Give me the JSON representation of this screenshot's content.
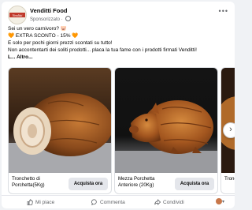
{
  "post": {
    "page_name": "Venditti Food",
    "sponsored_label": "Sponsorizzato · ",
    "logo_text": "Venditti",
    "more_icon": "more-horizontal-icon",
    "text_lines": [
      "Sei un vero carnivoro? 🐷",
      "🧡 EXTRA SCONTO - 15% 🧡",
      "E solo per pochi giorni prezzi scontati su tutto!",
      "",
      "Non accontentarti dei soliti prodotti... placa la tua fame con i prodotti firmati Venditti!",
      "L... Altro..."
    ]
  },
  "carousel": {
    "cards": [
      {
        "title": "Tronchetto di Porchetta(5Kg)",
        "cta": "Acquista ora"
      },
      {
        "title": "Mezza Porchetta Anteriore (20Kg)",
        "cta": "Acquista ora"
      },
      {
        "title": "Tronc Porche",
        "cta": ""
      }
    ],
    "next_icon": "chevron-right-icon"
  },
  "actions": {
    "like": "Mi piace",
    "comment": "Commenta",
    "share": "Condividi"
  }
}
